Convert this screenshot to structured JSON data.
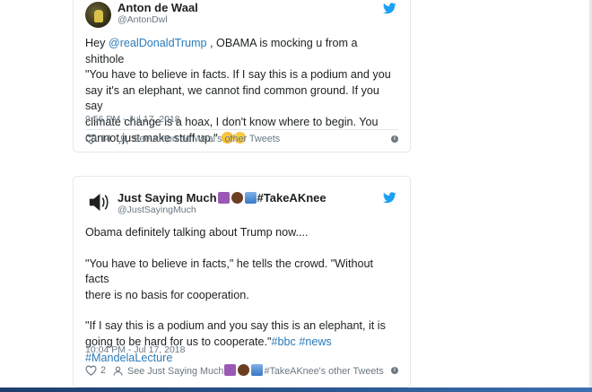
{
  "tweets": [
    {
      "name": "Anton de Waal",
      "handle": "@AntonDwl",
      "text": {
        "lines": [
          [
            {
              "t": "Hey "
            },
            {
              "t": "@realDonaldTrump",
              "link": true
            },
            {
              "t": " , OBAMA is mocking u from a shithole"
            }
          ],
          [
            {
              "t": "\"You have to believe in facts. If I say this is a podium and you"
            }
          ],
          [
            {
              "t": "say  it's an elephant, we cannot find common ground. If you say"
            }
          ],
          [
            {
              "t": "climate  change is a hoax, I don't know where to begin. You"
            }
          ],
          [
            {
              "t": "cannot just make  stuff up.\" "
            }
          ]
        ]
      },
      "emojis": [
        "rolling-on-floor-laughing",
        "smiling-face"
      ],
      "timestamp": "9:56 PM - Jul 17, 2018",
      "likes": "14",
      "other_tweets": "See Anton de Waal's other Tweets"
    },
    {
      "name": "Just Saying Much",
      "name_suffix": "#TakeAKnee",
      "handle": "@JustSayingMuch",
      "paragraphs": [
        [
          {
            "t": "Obama definitely talking about Trump now...."
          }
        ],
        [
          {
            "t": "\"You have to believe in facts,\" he tells the crowd. \"Without facts"
          },
          {
            "t": "there is no basis for cooperation."
          }
        ],
        [
          {
            "t": "\"If I say this is a podium and you say this is an elephant, it is"
          },
          {
            "t": "going to be hard for us to cooperate.\""
          }
        ]
      ],
      "hashtags": [
        "#bbc",
        "#news",
        "#MandelaLecture"
      ],
      "timestamp": "10:04 PM - Jul 17, 2018",
      "likes": "2",
      "other_tweets_prefix": "See Just Saying Much",
      "other_tweets_suffix": "#TakeAKnee's other Tweets"
    }
  ],
  "colors": {
    "link": "#2b7bb9",
    "twitter_bird": "#1da1f2",
    "muted": "#697882",
    "border": "#e1e8ed"
  },
  "icons": [
    "twitter-bird-icon",
    "heart-icon",
    "person-icon",
    "info-icon",
    "speaker-icon"
  ]
}
